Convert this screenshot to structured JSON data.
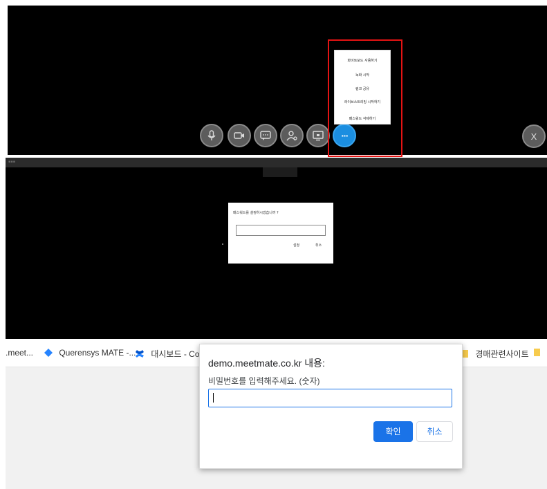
{
  "meeting": {
    "controls": [
      {
        "icon": "microphone-icon"
      },
      {
        "icon": "camera-icon"
      },
      {
        "icon": "chat-icon"
      },
      {
        "icon": "participants-icon"
      },
      {
        "icon": "screen-share-icon"
      },
      {
        "icon": "more-icon",
        "label": "···"
      },
      {
        "icon": "close-icon",
        "label": "X"
      }
    ],
    "menu_items": [
      "화이트보드 사용하기",
      "녹화 시작",
      "링크 공유",
      "라이브스트리밍 시작하기",
      "패스워드 삭제하기"
    ],
    "highlight_color": "#e41313",
    "accent_color": "#1b8ee0"
  },
  "password_dialog": {
    "title": "패스워드를 설정하시겠습니까 ?",
    "set_label": "설정",
    "cancel_label": "취소"
  },
  "browser": {
    "bookmarks": [
      ".meet...",
      "Querensys MATE -...",
      "대시보드 - Conf",
      "경매관련사이트"
    ],
    "prompt": {
      "title": "demo.meetmate.co.kr 내용:",
      "message": "비밀번호를 입력해주세요. (숫자)",
      "value": "",
      "ok_label": "확인",
      "cancel_label": "취소"
    },
    "accent_color": "#1a73e8"
  }
}
